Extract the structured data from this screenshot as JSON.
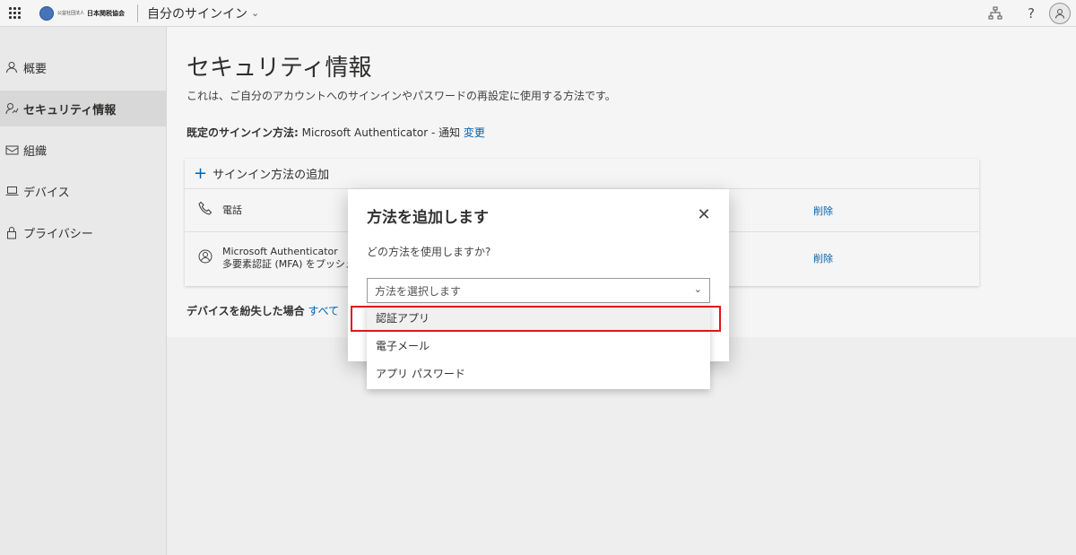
{
  "header": {
    "org_small": "公益社団法人",
    "org_name": "日本関税協会",
    "app_title": "自分のサインイン",
    "icons": [
      "waffle-icon",
      "org-chart-icon",
      "help-icon",
      "account-avatar-icon"
    ]
  },
  "sidebar": {
    "items": [
      {
        "label": "概要",
        "icon": "person-icon",
        "active": false
      },
      {
        "label": "セキュリティ情報",
        "icon": "security-info-icon",
        "active": true
      },
      {
        "label": "組織",
        "icon": "organization-icon",
        "active": false
      },
      {
        "label": "デバイス",
        "icon": "laptop-icon",
        "active": false
      },
      {
        "label": "プライバシー",
        "icon": "lock-icon",
        "active": false
      }
    ]
  },
  "main": {
    "title": "セキュリティ情報",
    "description": "これは、ご自分のアカウントへのサインインやパスワードの再設定に使用する方法です。",
    "default_label": "既定のサインイン方法:",
    "default_value": " Microsoft Authenticator - 通知 ",
    "change_link": "変更",
    "add_method": "サインイン方法の追加",
    "methods": [
      {
        "line1": "電話",
        "line2": "",
        "icon": "phone-icon",
        "delete": "削除"
      },
      {
        "line1": "Microsoft Authenticator",
        "line2": "多要素認証 (MFA) をプッシュ",
        "icon": "authenticator-icon",
        "delete": "削除"
      }
    ],
    "lost_label": "デバイスを紛失した場合",
    "lost_link": " すべて"
  },
  "dialog": {
    "title": "方法を追加します",
    "question": "どの方法を使用しますか?",
    "select_placeholder": "方法を選択します",
    "options": [
      "認証アプリ",
      "電子メール",
      "アプリ パスワード"
    ],
    "highlighted_option": "認証アプリ",
    "highlight_color": "#e0161b"
  },
  "colors": {
    "link": "#0067b8",
    "sidebar_bg": "#f3f3f3",
    "active_item_bg": "#e1e1e1"
  }
}
